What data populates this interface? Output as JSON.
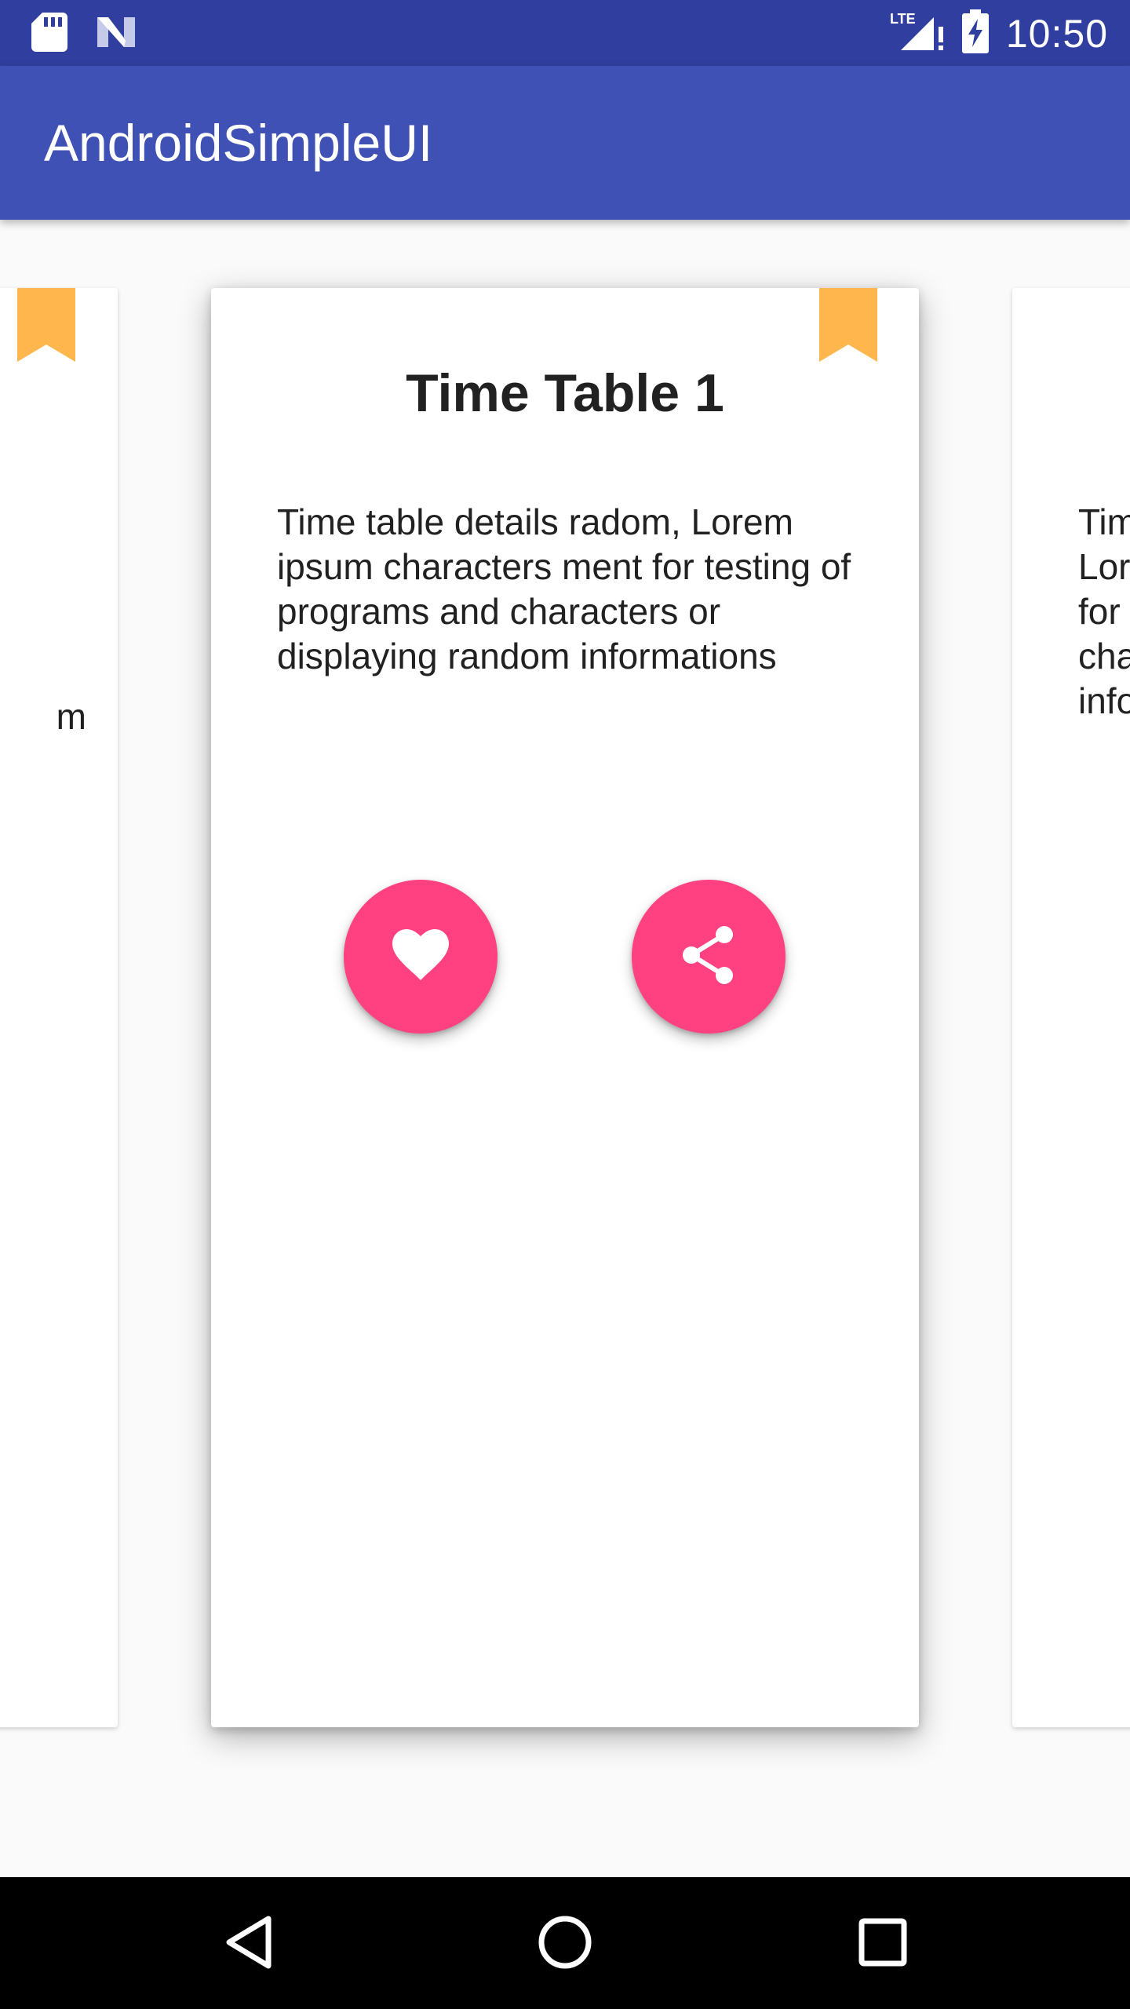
{
  "status_bar": {
    "time": "10:50",
    "network_label": "LTE",
    "icons": [
      "sd-card-icon",
      "n-logo-icon",
      "lte-signal-icon",
      "battery-charging-icon"
    ]
  },
  "app_bar": {
    "title": "AndroidSimpleUI",
    "color": "#3f51b5",
    "status_color": "#303f9f"
  },
  "cards": {
    "left": {
      "desc_fragment": "m"
    },
    "center": {
      "title": "Time Table 1",
      "description": "Time table details radom, Lorem ipsum characters ment for testing of programs and characters or displaying random informations",
      "like_icon": "heart-icon",
      "share_icon": "share-icon"
    },
    "right": {
      "desc_lines": [
        "Tim",
        "Lor",
        "for",
        "cha",
        "info"
      ]
    },
    "bookmark_color": "#ffb74d",
    "fab_color": "#ff4081"
  },
  "nav_bar": {
    "icons": [
      "back-icon",
      "home-icon",
      "recents-icon"
    ]
  }
}
